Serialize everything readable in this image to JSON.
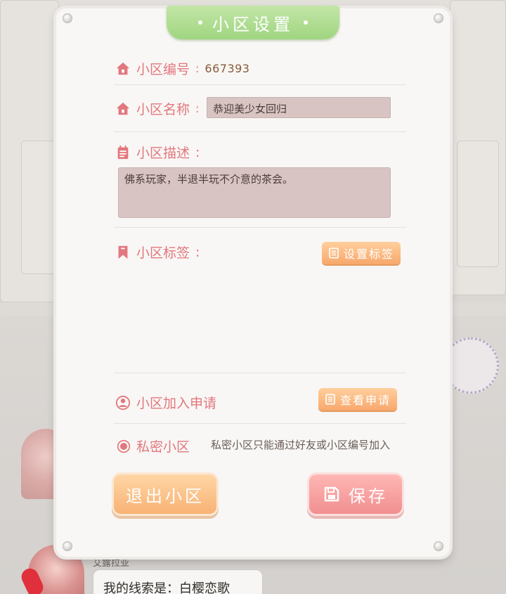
{
  "dialog": {
    "title": "小区设置",
    "community_id": {
      "label": "小区编号",
      "colon": ":",
      "value": "667393"
    },
    "community_name": {
      "label": "小区名称",
      "colon": ":",
      "value": "恭迎美少女回归"
    },
    "community_desc": {
      "label": "小区描述",
      "colon": ":",
      "value": "佛系玩家，半退半玩不介意的茶会。"
    },
    "community_tags": {
      "label": "小区标签",
      "colon": ":",
      "button": "设置标签"
    },
    "join_requests": {
      "label": "小区加入申请",
      "button": "查看申请"
    },
    "private": {
      "label": "私密小区",
      "description": "私密小区只能通过好友或小区编号加入"
    },
    "exit_button": "退出小区",
    "save_button": "保存"
  },
  "background": {
    "chat_name": "艾露拉亚",
    "chat_message": "我的线索是：白樱恋歌"
  },
  "colors": {
    "accent_pink": "#e3777e",
    "title_green": "#9fd580",
    "button_orange": "#f8a86c",
    "button_pink": "#f18f8f",
    "input_bg": "#d8c4c2"
  },
  "icons": {
    "id": "house-icon",
    "name": "house-icon",
    "desc": "notepad-icon",
    "tags": "bookmark-icon",
    "join": "user-icon",
    "private": "radio-icon",
    "tag_button": "list-icon",
    "join_button": "list-icon",
    "save": "floppy-disk-icon"
  }
}
